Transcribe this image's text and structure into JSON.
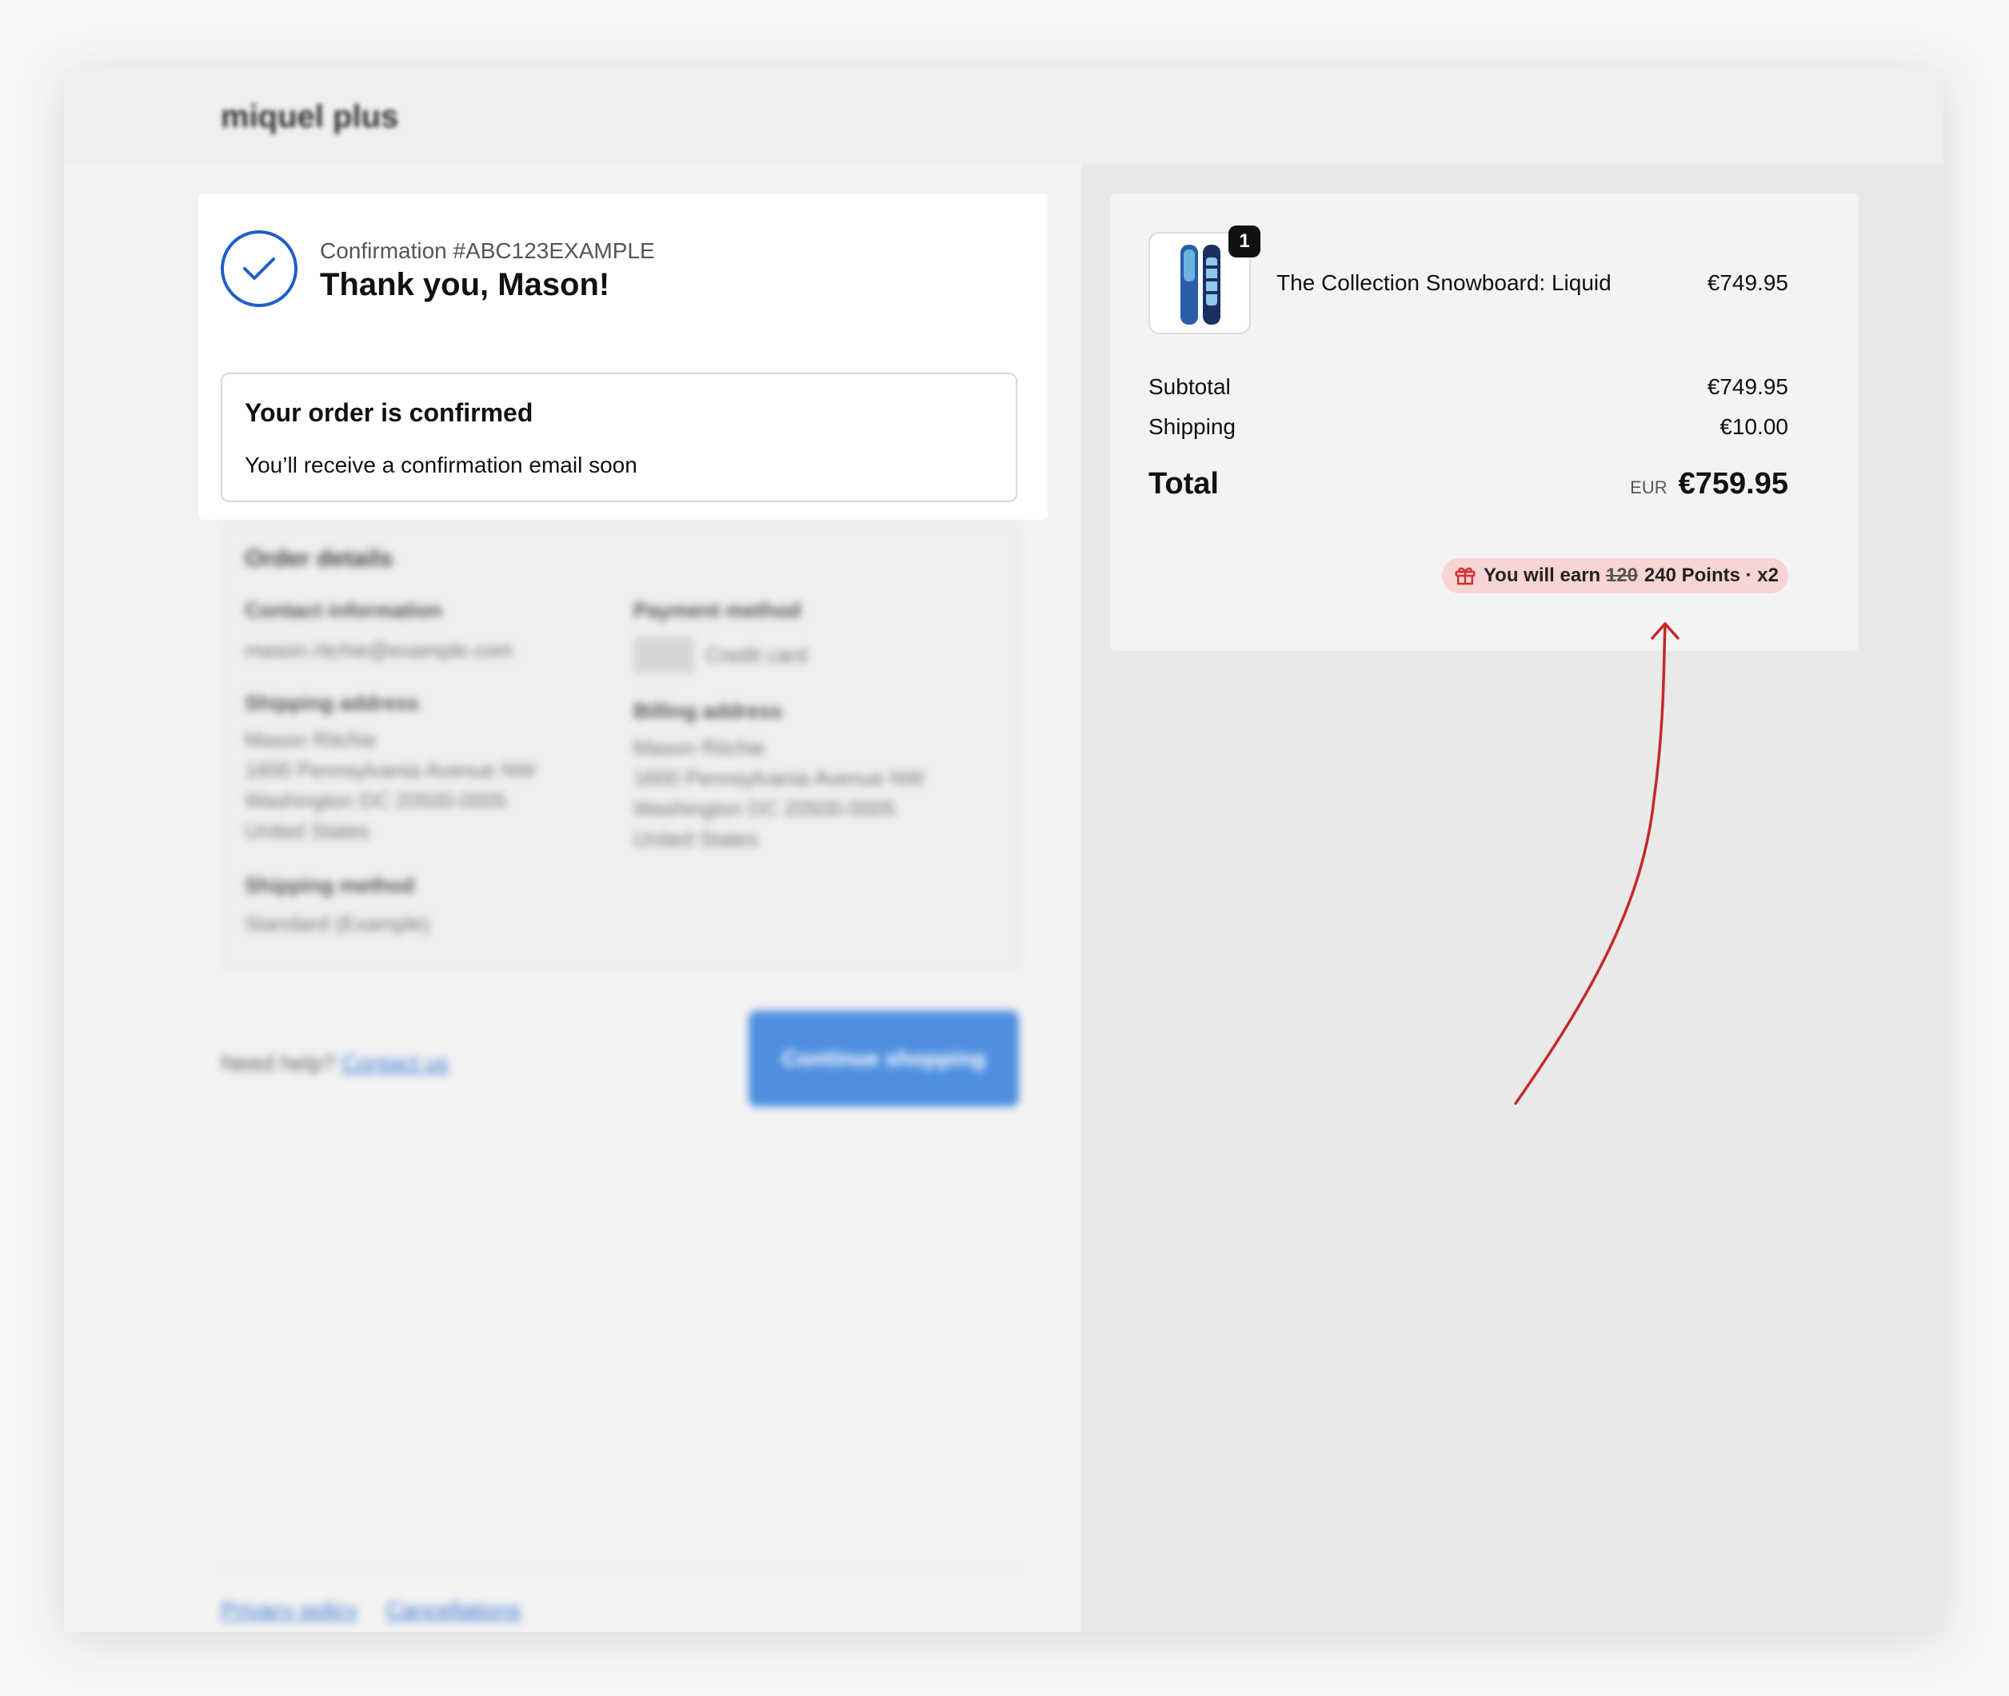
{
  "brand": "miquel plus",
  "confirmation": {
    "number": "Confirmation #ABC123EXAMPLE",
    "thank_you": "Thank you, Mason!",
    "status_title": "Your order is confirmed",
    "status_sub": "You’ll receive a confirmation email soon"
  },
  "order_details": {
    "title": "Order details",
    "contact_label": "Contact information",
    "contact_email": "mason.ritchie@example.com",
    "payment_label": "Payment method",
    "payment_value": "Credit card",
    "shipping_address_label": "Shipping address",
    "shipping_address": "Mason Ritchie\n1600 Pennsylvania Avenue NW\nWashington DC 20500-0005\nUnited States",
    "billing_address_label": "Billing address",
    "billing_address": "Mason Ritchie\n1600 Pennsylvania Avenue NW\nWashington DC 20500-0005\nUnited States",
    "shipping_method_label": "Shipping method",
    "shipping_method": "Standard (Example)"
  },
  "help": {
    "text": "Need help?",
    "link": "Contact us"
  },
  "continue_label": "Continue shopping",
  "footer": {
    "privacy": "Privacy policy",
    "cancellations": "Cancellations"
  },
  "summary": {
    "quantity": "1",
    "product_name": "The Collection Snowboard: Liquid",
    "product_price": "€749.95",
    "subtotal_label": "Subtotal",
    "subtotal": "€749.95",
    "shipping_label": "Shipping",
    "shipping": "€10.00",
    "total_label": "Total",
    "currency": "EUR",
    "total": "€759.95"
  },
  "points": {
    "prefix": "You will earn",
    "old": "120",
    "new": "240 Points · x2"
  },
  "colors": {
    "accent": "#1f5fc6",
    "button": "#4f8fe0",
    "points_bg": "#f9d4d4",
    "arrow": "#c62828"
  }
}
